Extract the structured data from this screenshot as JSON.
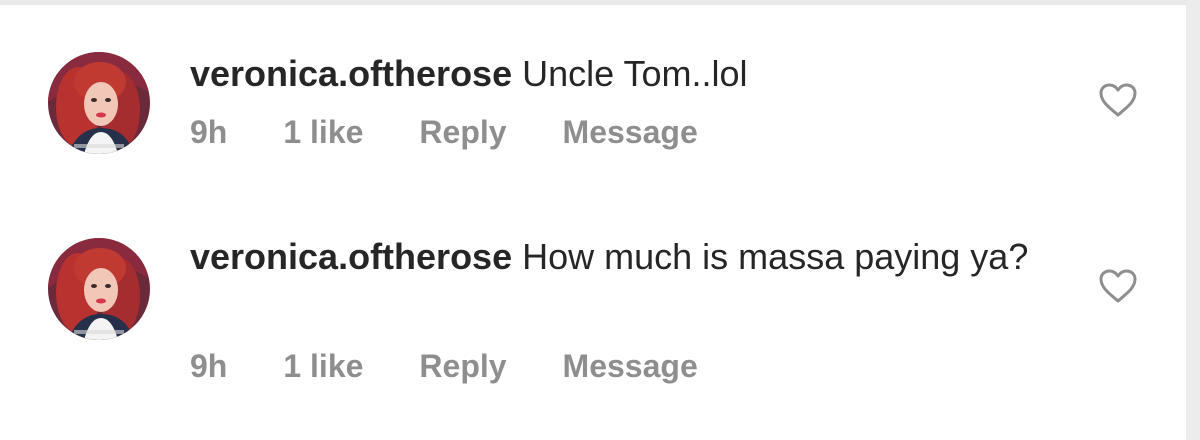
{
  "comments": [
    {
      "username": "veronica.oftherose",
      "text": "Uncle Tom..lol",
      "time": "9h",
      "likes": "1 like",
      "reply_label": "Reply",
      "message_label": "Message",
      "avatar_icon": "profile-photo",
      "like_icon": "heart-outline-icon"
    },
    {
      "username": "veronica.oftherose",
      "text": "How much is massa paying ya?",
      "time": "9h",
      "likes": "1 like",
      "reply_label": "Reply",
      "message_label": "Message",
      "avatar_icon": "profile-photo",
      "like_icon": "heart-outline-icon"
    }
  ],
  "colors": {
    "text": "#262626",
    "meta": "#8e8e8e",
    "heart_stroke": "#8e8e8e"
  }
}
